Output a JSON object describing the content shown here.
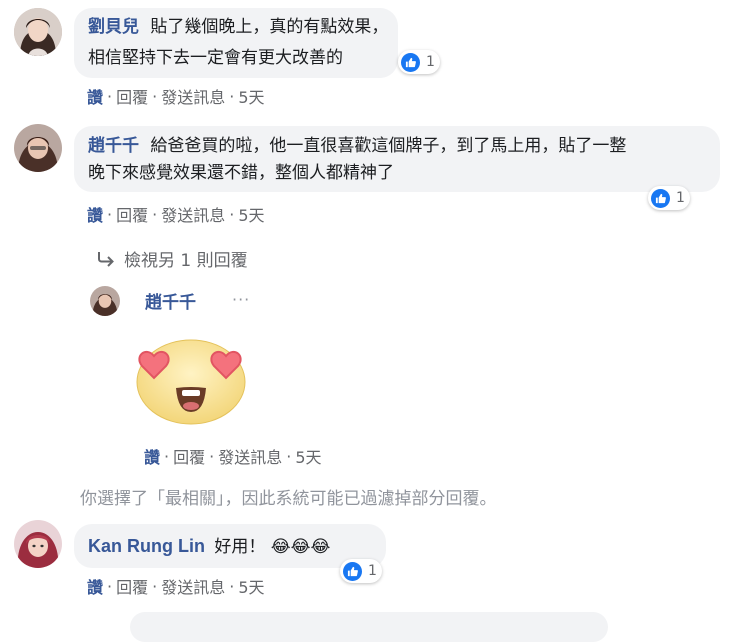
{
  "comments": [
    {
      "author": "劉貝兒",
      "text_lines": [
        "貼了幾個晚上，真的有點效果，",
        "相信堅持下去一定會有更大改善的"
      ],
      "reaction_count": "1",
      "actions": {
        "like": "讚",
        "reply": "回覆",
        "message": "發送訊息",
        "time": "5天"
      }
    },
    {
      "author": "趙千千",
      "text_lines": [
        "給爸爸買的啦，他一直很喜歡這個牌子，到了馬上用，貼了一整",
        "晚下來感覺效果還不錯，整個人都精神了"
      ],
      "reaction_count": "1",
      "actions": {
        "like": "讚",
        "reply": "回覆",
        "message": "發送訊息",
        "time": "5天"
      },
      "view_replies": "檢視另 1 則回覆",
      "reply": {
        "author": "趙千千",
        "more": "···",
        "emoji": "heart-eyes",
        "actions": {
          "like": "讚",
          "reply": "回覆",
          "message": "發送訊息",
          "time": "5天"
        }
      }
    },
    {
      "author": "Kan Rung Lin",
      "text": "好用！",
      "emojis": "😂😂😂",
      "reaction_count": "1",
      "actions": {
        "like": "讚",
        "reply": "回覆",
        "message": "發送訊息",
        "time": "5天"
      }
    }
  ],
  "filter_notice": "你選擇了「最相關」，因此系統可能已過濾掉部分回覆。",
  "colors": {
    "link": "#385898",
    "meta": "#65676b",
    "bubble": "#f2f3f5",
    "like": "#1877f2"
  }
}
